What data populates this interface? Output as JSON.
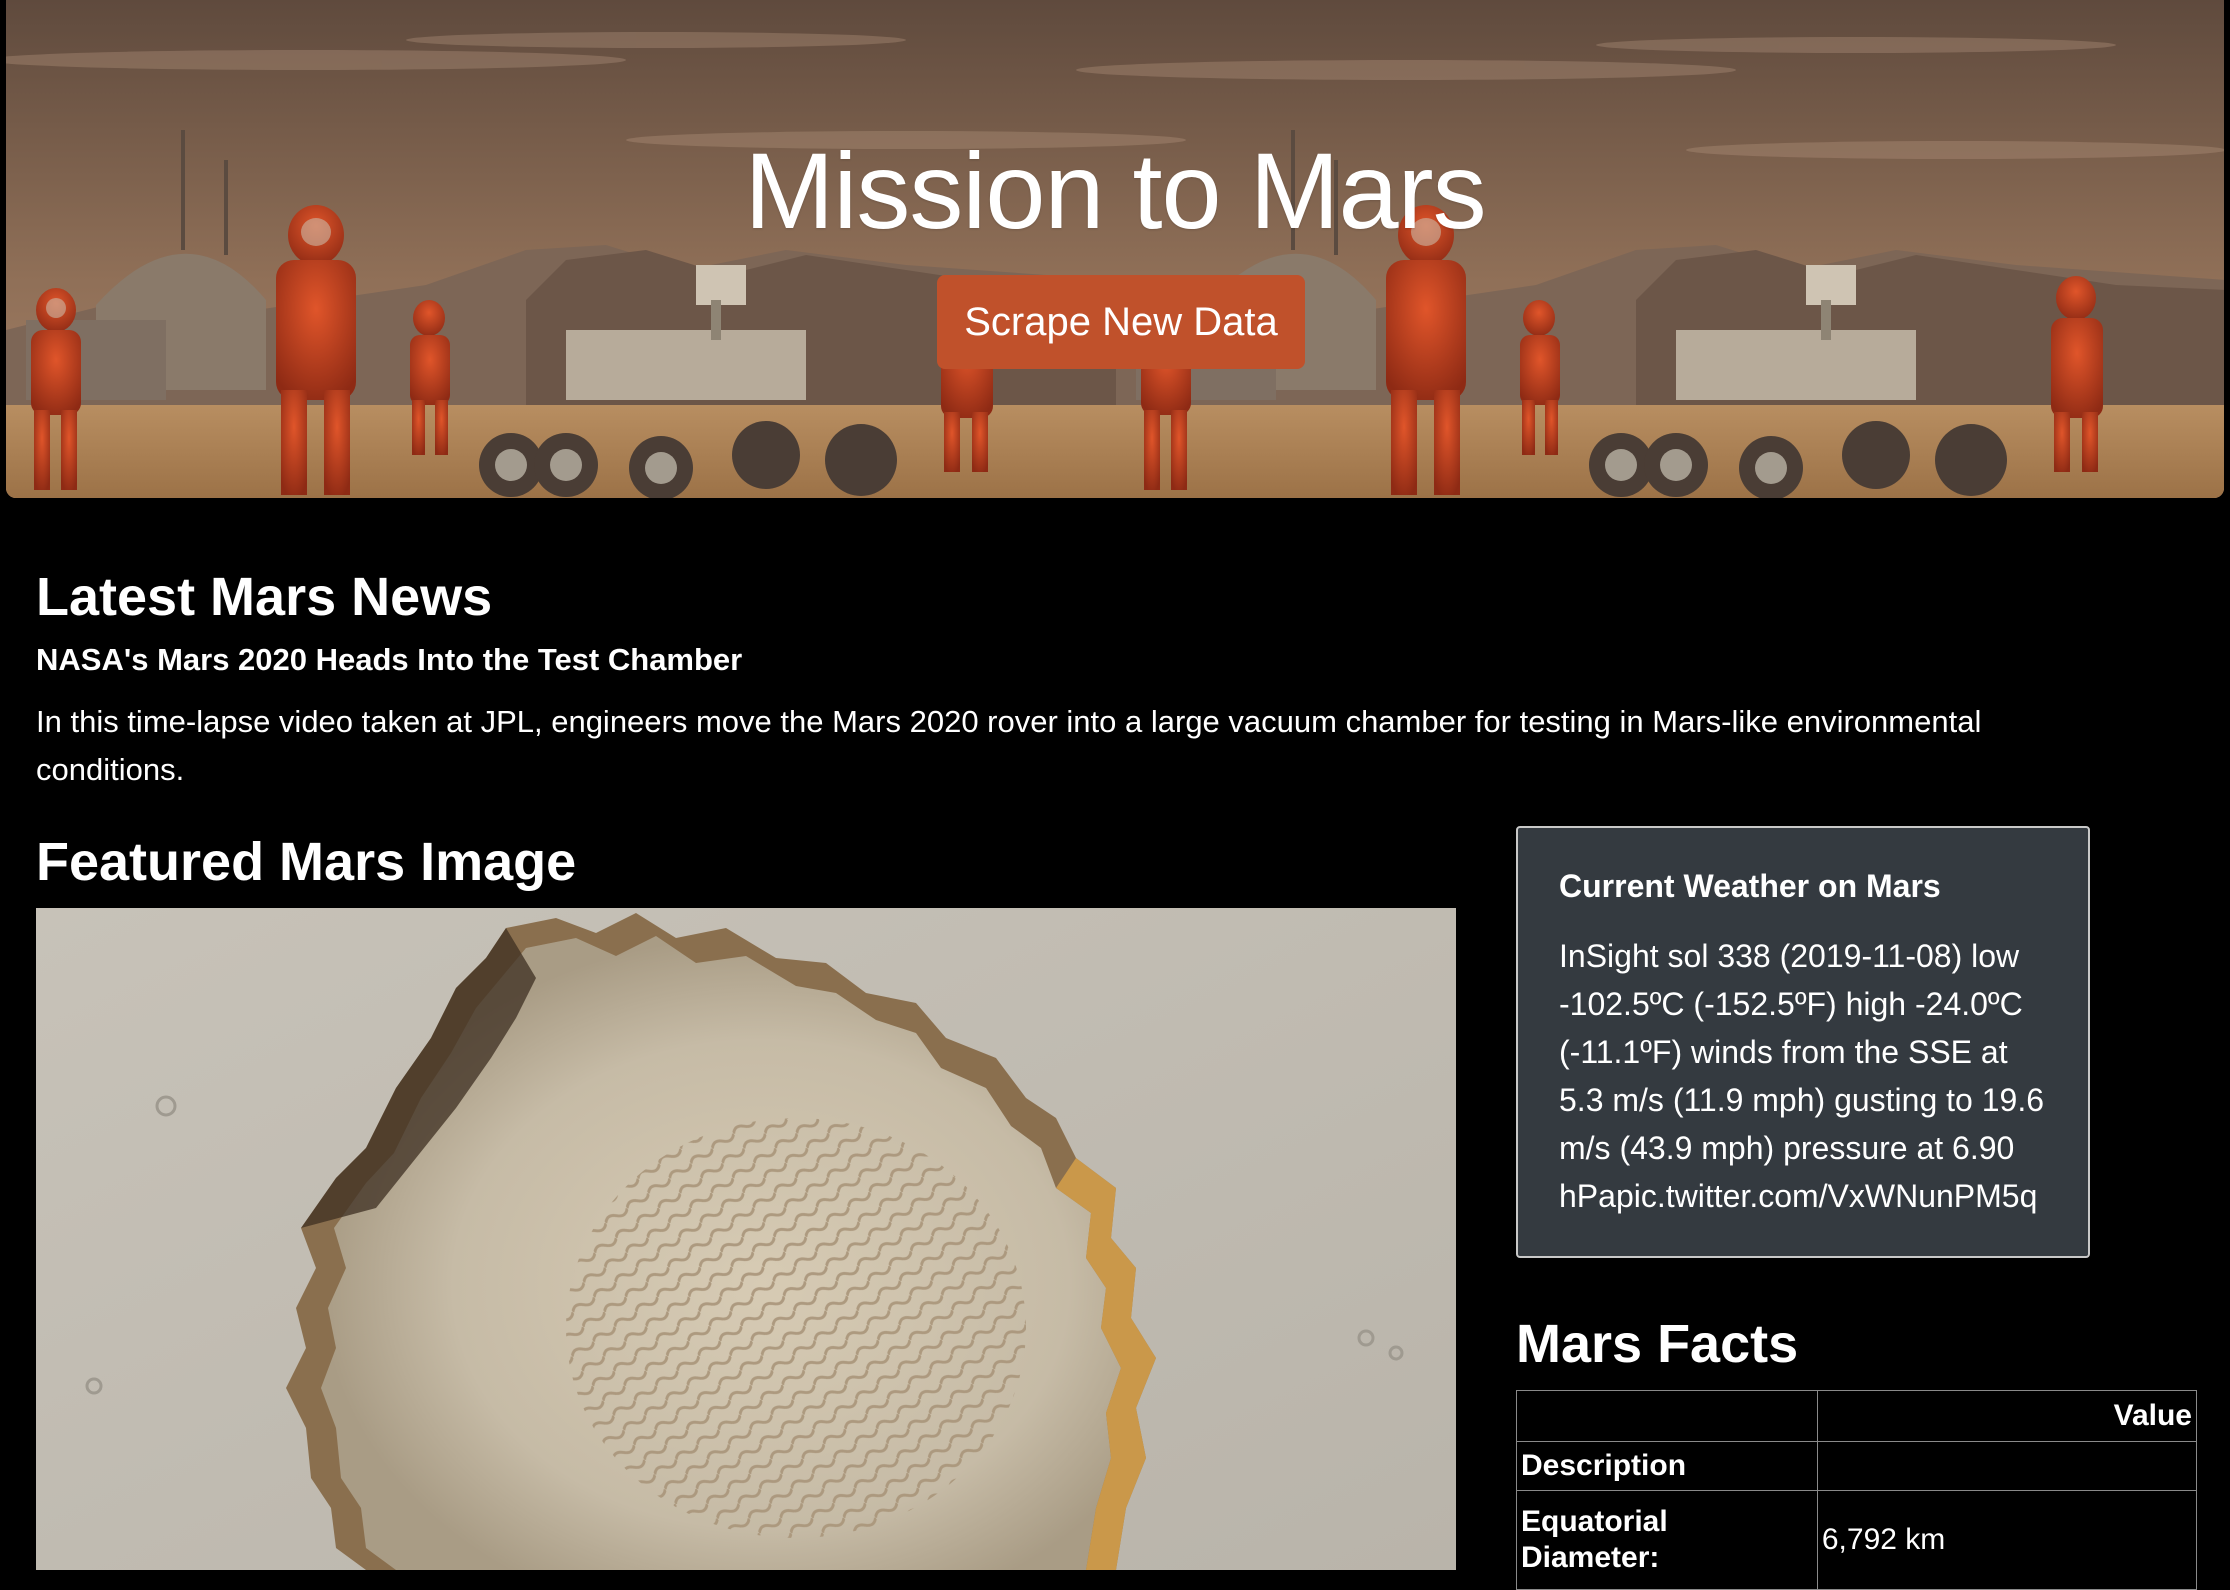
{
  "hero": {
    "title": "Mission to Mars",
    "button_label": "Scrape New Data",
    "button_color": "#c0512b"
  },
  "news": {
    "heading": "Latest Mars News",
    "title": "NASA's Mars 2020 Heads Into the Test Chamber",
    "paragraph": "In this time-lapse video taken at JPL, engineers move the Mars 2020 rover into a large vacuum chamber for testing in Mars-like environmental conditions."
  },
  "featured": {
    "heading": "Featured Mars Image"
  },
  "weather": {
    "title": "Current Weather on Mars",
    "text": "InSight sol 338 (2019-11-08) low -102.5ºC (-152.5ºF) high -24.0ºC (-11.1ºF) winds from the SSE at 5.3 m/s (11.9 mph) gusting to 19.6 m/s (43.9 mph) pressure at 6.90 hPapic.twitter.com/VxWNunPM5q",
    "card_bg": "#343a40"
  },
  "facts": {
    "heading": "Mars Facts",
    "header_value": "Value",
    "index_label": "Description",
    "rows": [
      {
        "label": "Equatorial Diameter:",
        "value": "6,792 km"
      }
    ]
  }
}
